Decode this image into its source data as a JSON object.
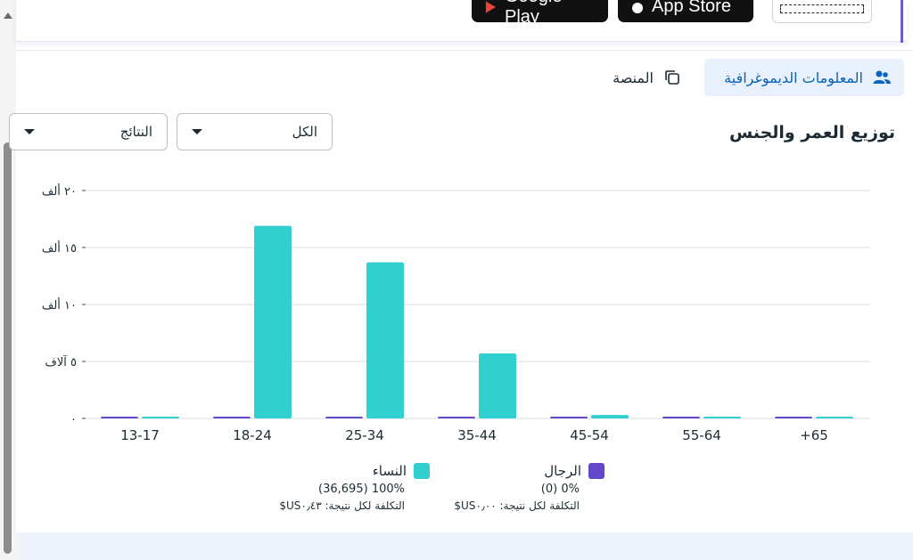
{
  "top_bar": {
    "google_play_label": "Google Play",
    "app_store_label": "App Store"
  },
  "tabs": [
    {
      "label": "المعلومات الديموغرافية",
      "icon": "people-icon",
      "active": true
    },
    {
      "label": "المنصة",
      "icon": "copy-icon",
      "active": false
    }
  ],
  "section": {
    "title": "توزيع العمر والجنس",
    "filter_all": "الكل",
    "filter_results": "النتائج"
  },
  "colors": {
    "women": "#31cfce",
    "men": "#6447c9",
    "accent": "#0a63b8",
    "grid": "#dadde1"
  },
  "chart_data": {
    "type": "bar",
    "categories": [
      "13-17",
      "18-24",
      "25-34",
      "35-44",
      "45-54",
      "55-64",
      "+65"
    ],
    "y_tick_labels": [
      "٠",
      "٥ آلاف",
      "١٠ ألف",
      "١٥ ألف",
      "٢٠ ألف"
    ],
    "ylim": [
      0,
      20000
    ],
    "grid": true,
    "series": [
      {
        "name": "الرجال",
        "values": [
          0,
          0,
          0,
          0,
          0,
          0,
          0
        ]
      },
      {
        "name": "النساء",
        "values": [
          0,
          16900,
          13700,
          5700,
          300,
          0,
          0
        ]
      }
    ]
  },
  "legend": {
    "men": {
      "name": "الرجال",
      "stat": "0% (0)",
      "cost": "التكلفة لكل نتيجة: ‏٠٫٠٠‏US$"
    },
    "women": {
      "name": "النساء",
      "stat": "100% (36,695)",
      "cost": "التكلفة لكل نتيجة: ‏٠٫٤٣‏US$"
    }
  }
}
